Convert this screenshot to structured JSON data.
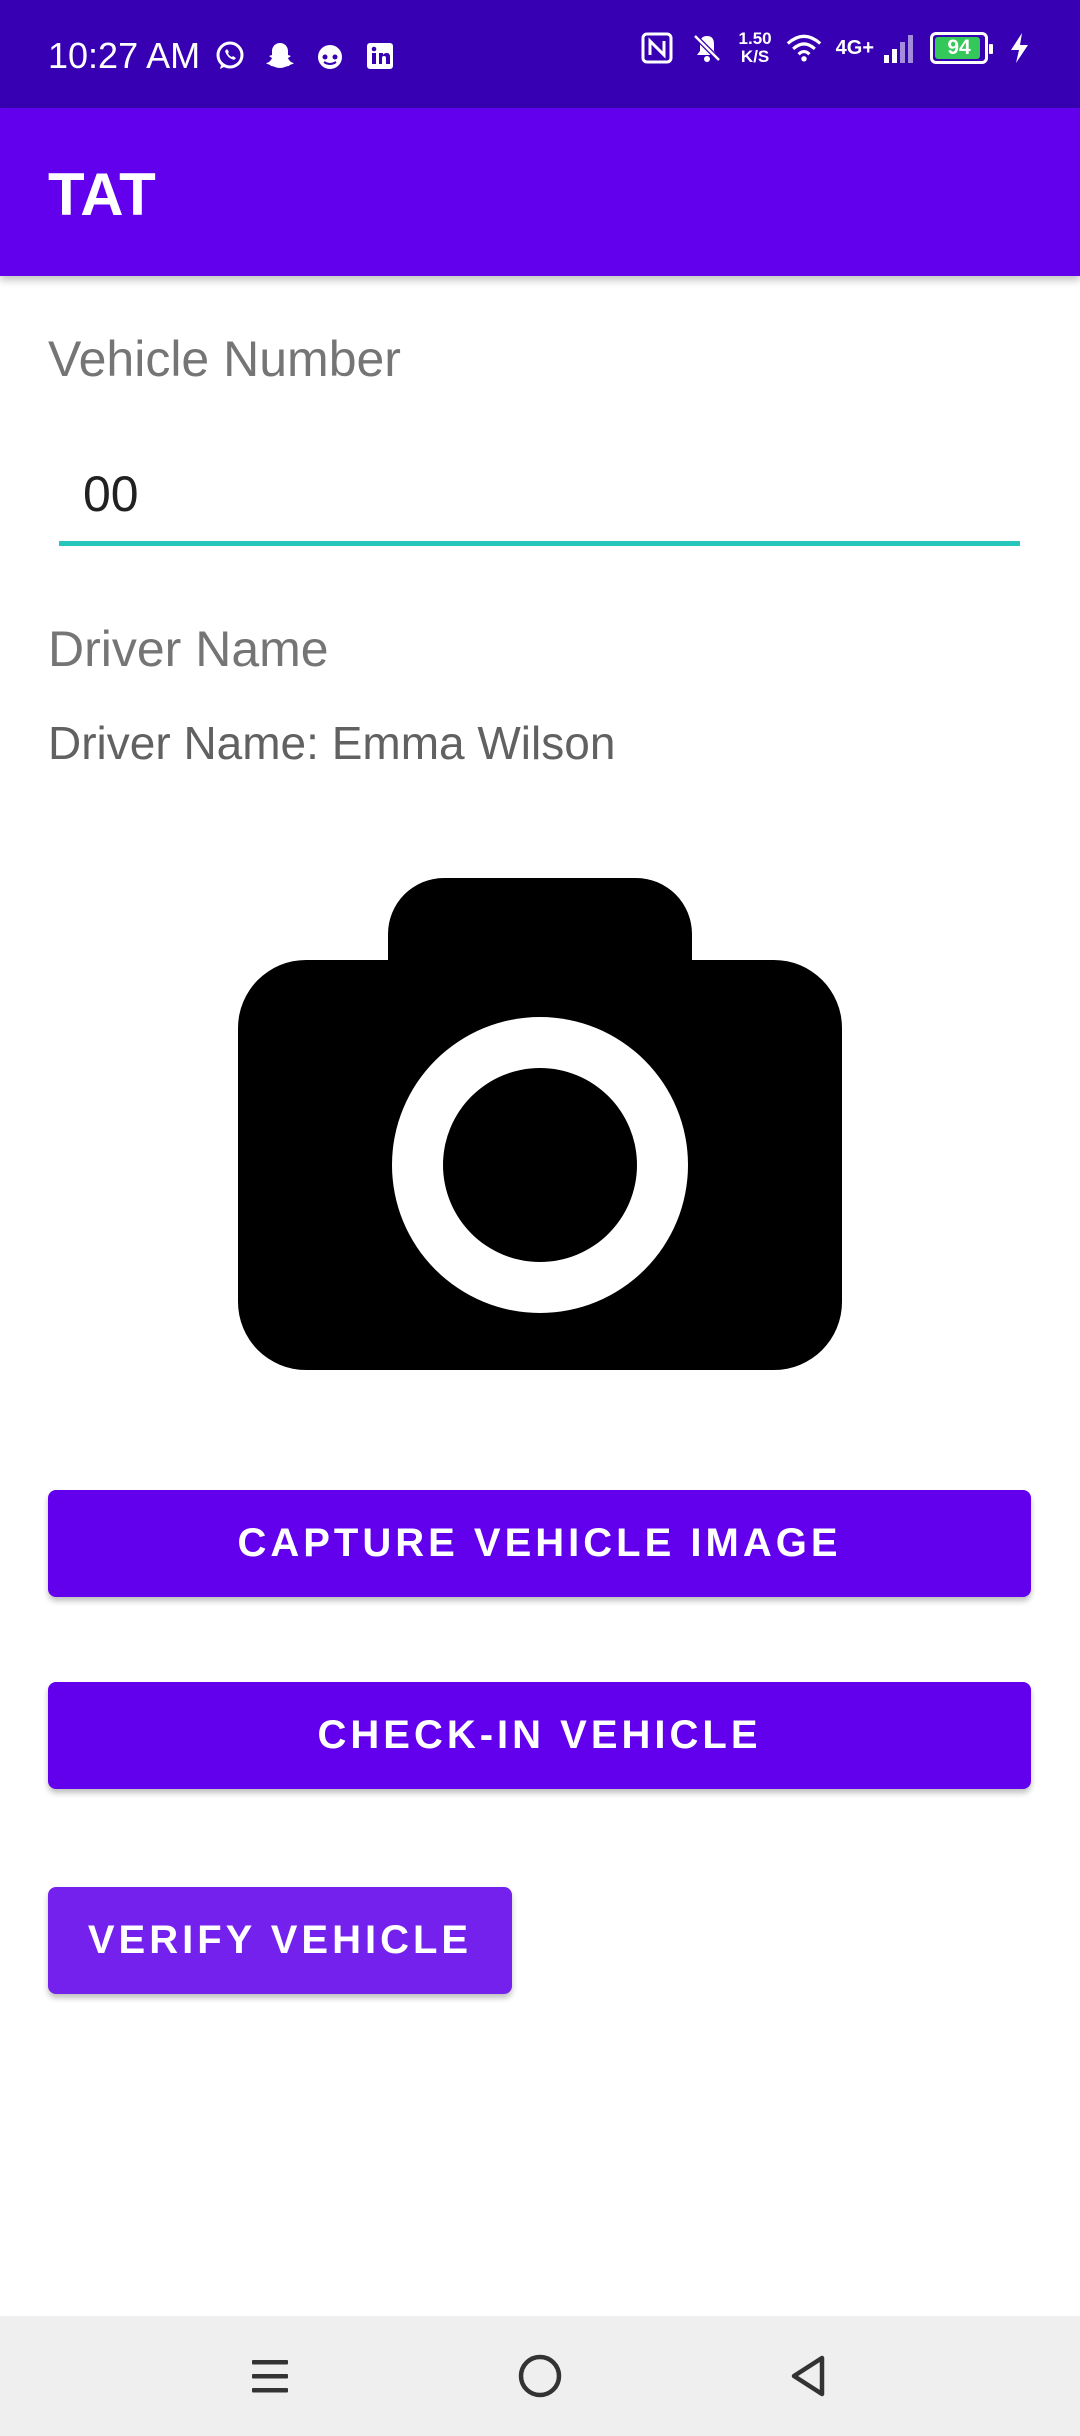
{
  "status_bar": {
    "time": "10:27 AM",
    "left_icons": [
      "whatsapp-icon",
      "snapchat-icon",
      "reddit-icon",
      "linkedin-icon"
    ],
    "right_icons": [
      "nfc-icon",
      "mute-icon",
      "wifi-icon",
      "signal-icon",
      "battery-icon",
      "charging-icon"
    ],
    "speed_value": "1.50",
    "speed_unit": "K/S",
    "network": "4G+",
    "battery_level": "94",
    "battery_fraction": 0.94,
    "battery_color": "#34C759"
  },
  "app_bar": {
    "title": "TAT",
    "color": "#6200EE"
  },
  "form": {
    "vehicle_number_label": "Vehicle Number",
    "vehicle_number_value": "00",
    "driver_name_label": "Driver Name",
    "driver_name_value": "Driver Name: Emma Wilson",
    "input_underline_color": "#26C6BA"
  },
  "image_preview": {
    "icon": "camera-icon"
  },
  "buttons": {
    "capture": "CAPTURE VEHICLE IMAGE",
    "checkin": "CHECK-IN VEHICLE",
    "verify": "VERIFY VEHICLE"
  },
  "nav_bar": {
    "icons": [
      "menu-icon",
      "home-icon",
      "back-icon"
    ]
  }
}
